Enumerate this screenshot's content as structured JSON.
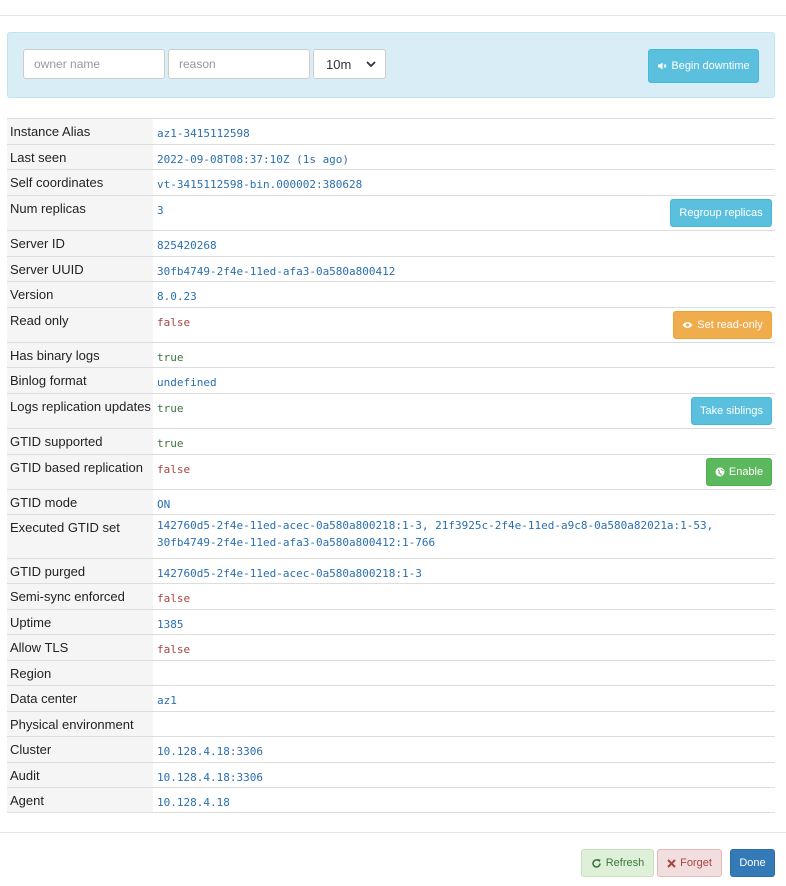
{
  "downtime": {
    "owner_placeholder": "owner name",
    "reason_placeholder": "reason",
    "duration_value": "10m",
    "begin_label": "Begin downtime"
  },
  "properties": [
    {
      "label": "Instance Alias",
      "value": "az1-3415112598",
      "color": "blue"
    },
    {
      "label": "Last seen",
      "value": "2022-09-08T08:37:10Z (1s ago)",
      "color": "blue"
    },
    {
      "label": "Self coordinates",
      "value": "vt-3415112598-bin.000002:380628",
      "color": "blue"
    },
    {
      "label": "Num replicas",
      "value": "3",
      "color": "blue",
      "action": "Regroup replicas"
    },
    {
      "label": "Server ID",
      "value": "825420268",
      "color": "blue"
    },
    {
      "label": "Server UUID",
      "value": "30fb4749-2f4e-11ed-afa3-0a580a800412",
      "color": "blue"
    },
    {
      "label": "Version",
      "value": "8.0.23",
      "color": "blue"
    },
    {
      "label": "Read only",
      "value": "false",
      "color": "red",
      "action": "Set read-only"
    },
    {
      "label": "Has binary logs",
      "value": "true",
      "color": "green"
    },
    {
      "label": "Binlog format",
      "value": "undefined",
      "color": "blue"
    },
    {
      "label": "Logs replication updates",
      "value": "true",
      "color": "green",
      "action": "Take siblings"
    },
    {
      "label": "GTID supported",
      "value": "true",
      "color": "green"
    },
    {
      "label": "GTID based replication",
      "value": "false",
      "color": "red",
      "action": "Enable"
    },
    {
      "label": "GTID mode",
      "value": "ON",
      "color": "blue"
    },
    {
      "label": "Executed GTID set",
      "value": "142760d5-2f4e-11ed-acec-0a580a800218:1-3, 21f3925c-2f4e-11ed-a9c8-0a580a82021a:1-53,",
      "value2": "30fb4749-2f4e-11ed-afa3-0a580a800412:1-766",
      "color": "blue"
    },
    {
      "label": "GTID purged",
      "value": "142760d5-2f4e-11ed-acec-0a580a800218:1-3",
      "color": "blue"
    },
    {
      "label": "Semi-sync enforced",
      "value": "false",
      "color": "red"
    },
    {
      "label": "Uptime",
      "value": "1385",
      "color": "blue"
    },
    {
      "label": "Allow TLS",
      "value": "false",
      "color": "red"
    },
    {
      "label": "Region",
      "value": "",
      "color": "blue"
    },
    {
      "label": "Data center",
      "value": "az1",
      "color": "blue"
    },
    {
      "label": "Physical environment",
      "value": "",
      "color": "blue"
    },
    {
      "label": "Cluster",
      "value": "10.128.4.18:3306",
      "color": "blue"
    },
    {
      "label": "Audit",
      "value": "10.128.4.18:3306",
      "color": "blue"
    },
    {
      "label": "Agent",
      "value": "10.128.4.18",
      "color": "blue"
    }
  ],
  "footer": {
    "refresh_label": "Refresh",
    "forget_label": "Forget",
    "done_label": "Done"
  }
}
